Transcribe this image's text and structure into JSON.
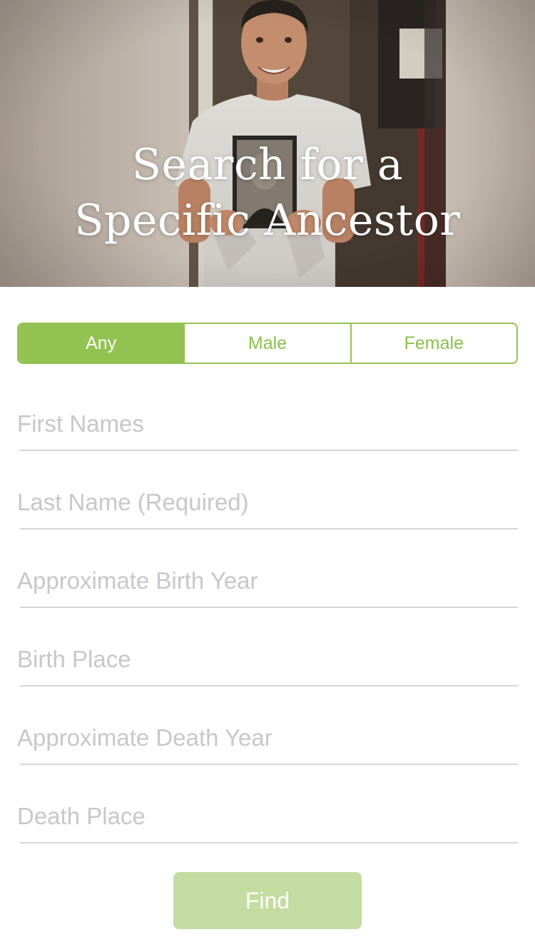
{
  "hero": {
    "title_line1": "Search for a",
    "title_line2": "Specific Ancestor"
  },
  "gender": {
    "options": [
      "Any",
      "Male",
      "Female"
    ],
    "selected": "Any"
  },
  "fields": {
    "first_names": {
      "placeholder": "First Names",
      "value": ""
    },
    "last_name": {
      "placeholder": "Last Name (Required)",
      "value": ""
    },
    "birth_year": {
      "placeholder": "Approximate Birth Year",
      "value": ""
    },
    "birth_place": {
      "placeholder": "Birth Place",
      "value": ""
    },
    "death_year": {
      "placeholder": "Approximate Death Year",
      "value": ""
    },
    "death_place": {
      "placeholder": "Death Place",
      "value": ""
    }
  },
  "find_button": {
    "label": "Find"
  },
  "colors": {
    "accent": "#92c352",
    "button_disabled": "#c4dca1",
    "placeholder": "#c7c7cd",
    "divider": "#d6d6d6"
  },
  "hero_photo_icon": "boy-holding-old-photograph"
}
